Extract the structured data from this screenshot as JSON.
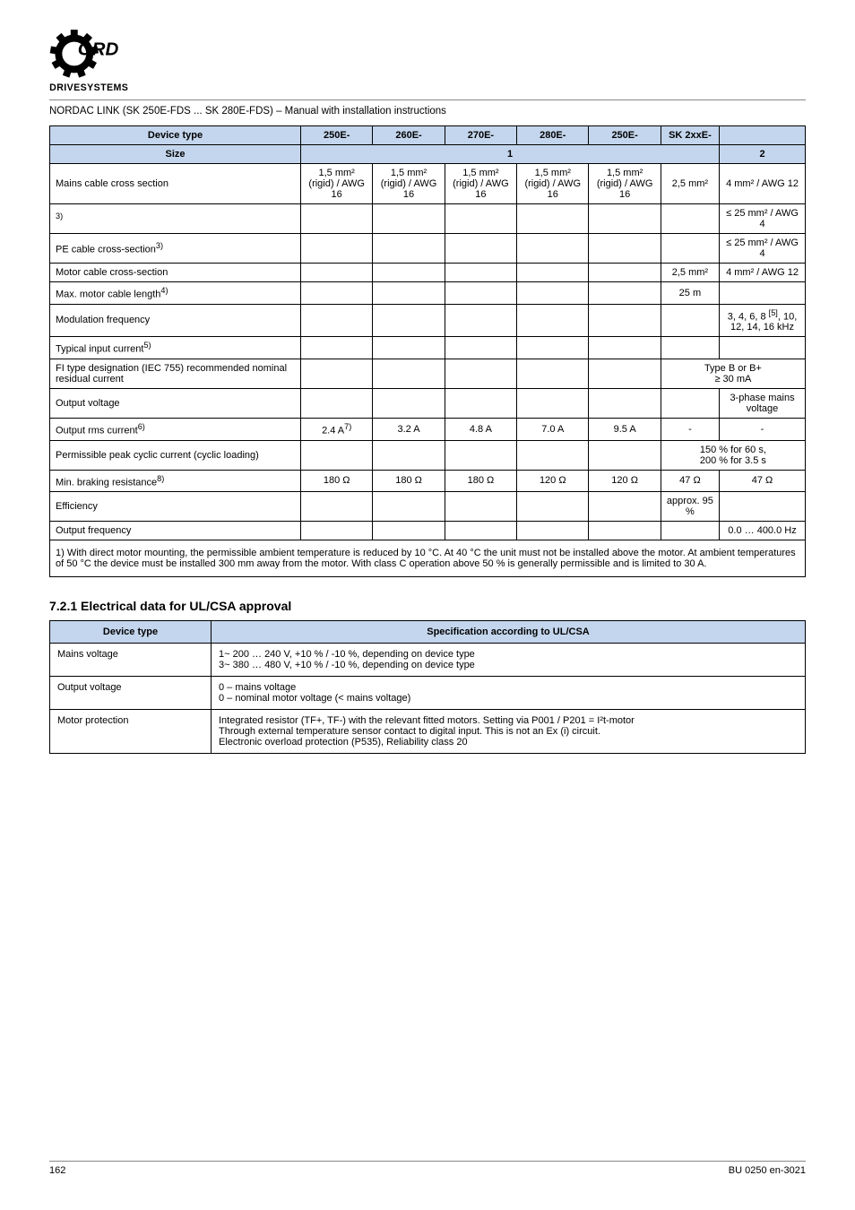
{
  "logo": {
    "brand": "NORD",
    "sub": "DRIVESYSTEMS"
  },
  "header": {
    "left": "NORDAC LINK (SK 250E-FDS ... SK 280E-FDS) – Manual with installation instructions",
    "right_icon": "nord-gear-icon"
  },
  "table1": {
    "header_row": [
      "Device type",
      "250E-",
      "260E-",
      "270E-",
      "280E-",
      "250E-",
      "SK 2xxE-",
      ""
    ],
    "subheader_row": [
      "Size",
      {
        "span": 6,
        "text": "1"
      },
      "2"
    ],
    "rows": [
      {
        "label": "Mains cable cross section",
        "vals": [
          "1,5 mm² (rigid) / AWG 16",
          "1,5 mm² (rigid) / AWG 16",
          "1,5 mm² (rigid) / AWG 16",
          "1,5 mm² (rigid) / AWG 16",
          "1,5 mm² (rigid) / AWG 16",
          "2,5 mm²",
          "4 mm² / AWG 12"
        ]
      },
      {
        "label": "<sup>3)</sup>",
        "vals": [
          "",
          "",
          "",
          "",
          "",
          "",
          "≤ 25 mm² / AWG 4"
        ]
      },
      {
        "label": "PE cable cross-section<sup>3)</sup>",
        "vals": [
          "",
          "",
          "",
          "",
          "",
          "",
          "≤ 25 mm² / AWG 4"
        ]
      },
      {
        "label": "Motor cable cross-section",
        "vals": [
          "",
          "",
          "",
          "",
          "",
          "2,5 mm²",
          "4 mm² / AWG 12"
        ]
      },
      {
        "label": "Max. motor cable length<sup>4)</sup>",
        "vals": [
          "",
          "",
          "",
          "",
          "",
          "25 m",
          ""
        ]
      },
      {
        "label": "Modulation frequency",
        "vals": [
          "",
          "",
          "",
          "",
          "",
          "",
          "3, 4, 6, 8 <sup>[5]</sup>, 10, 12, 14, 16 kHz"
        ]
      },
      {
        "label": "Typical input current<sup>5)</sup>",
        "vals": [
          "",
          "",
          "",
          "",
          "",
          "",
          ""
        ]
      },
      {
        "label": "FI type designation (IEC 755) recommended nominal residual current",
        "vals": [
          "",
          "",
          "",
          "",
          "",
          "",
          ""
        ],
        "extra": "Type B or B+<br>≥ 30 mA"
      },
      {
        "label": "Output voltage",
        "vals": [
          "",
          "",
          "",
          "",
          "",
          "",
          "3-phase mains voltage"
        ]
      },
      {
        "label": "Output rms current<sup>6)</sup>",
        "vals": [
          "2.4 A<sup>7)</sup>",
          "3.2 A",
          "4.8 A",
          "7.0 A",
          "9.5 A",
          "-",
          "-"
        ]
      },
      {
        "label": "Permissible peak cyclic current (cyclic loading)",
        "vals": [
          "",
          "",
          "",
          "",
          "",
          "",
          ""
        ],
        "extra": "150 % for 60 s,<br>200 % for 3.5 s"
      },
      {
        "label": "Min. braking resistance<sup>8)</sup>",
        "vals": [
          "180 Ω",
          "180 Ω",
          "180 Ω",
          "120 Ω",
          "120 Ω",
          "47 Ω",
          "47 Ω"
        ]
      },
      {
        "label": "Efficiency",
        "vals": [
          "",
          "",
          "",
          "",
          "",
          "approx. 95 %",
          ""
        ]
      },
      {
        "label": "Output frequency",
        "vals": [
          "",
          "",
          "",
          "",
          "",
          "",
          "0.0 … 400.0 Hz"
        ]
      }
    ],
    "note": "1) With direct motor mounting, the permissible ambient temperature is reduced by 10 °C. At 40 °C the unit must not be installed above the motor. At ambient temperatures of 50 °C the device must be installed 300 mm away from the motor. With class C operation above 50 % is generally permissible and is limited to 30 A."
  },
  "subsection_title": "7.2.1  Electrical data for UL/CSA approval",
  "table2": {
    "cols": [
      "Device type",
      "Specification according to UL/CSA"
    ],
    "rows": [
      {
        "type": "Mains voltage",
        "spec": "1~ 200 … 240 V, +10 % / -10 %, depending on device type<br>3~ 380 … 480 V, +10 % / -10 %, depending on device type"
      },
      {
        "type": "Output voltage",
        "spec": "0 – mains voltage<br>0 – nominal motor voltage (< mains voltage)"
      },
      {
        "type": "Motor protection",
        "spec": "Integrated resistor (TF+, TF-) with the relevant fitted motors. Setting via P001 / P201 = I²t-motor<br>Through external temperature sensor contact to digital input. This is not an Ex (i) circuit.<br>Electronic overload protection (P535), Reliability class 20"
      }
    ]
  },
  "footer": {
    "left": "162",
    "right": "BU 0250 en-3021"
  }
}
